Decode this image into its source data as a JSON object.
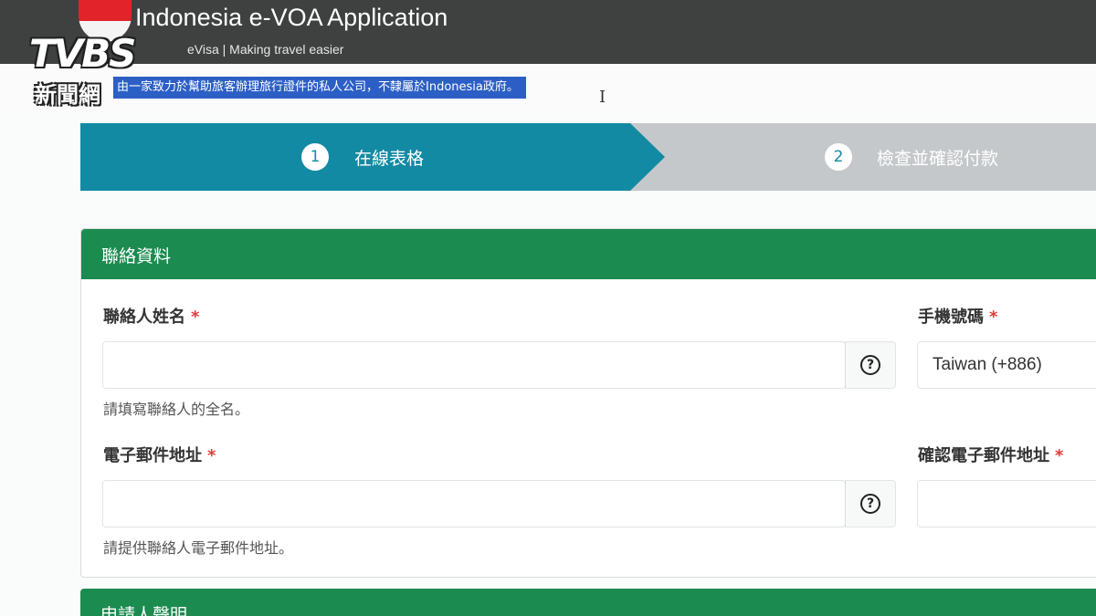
{
  "header": {
    "title": "Indonesia e-VOA Application",
    "subtitle": "eVisa | Making travel easier"
  },
  "watermark": {
    "logo": "TVBS",
    "channel": "新聞網"
  },
  "disclaimer": "由一家致力於幫助旅客辦理旅行證件的私人公司，不隸屬於Indonesia政府。",
  "steps": [
    {
      "number": "1",
      "label": "在線表格",
      "active": true
    },
    {
      "number": "2",
      "label": "檢查並確認付款",
      "active": false
    }
  ],
  "contact_section": {
    "title": "聯絡資料",
    "contact_name": {
      "label": "聯絡人姓名",
      "required_mark": "*",
      "value": "",
      "hint": "請填寫聯絡人的全名。",
      "help_icon": "question-circle-icon"
    },
    "phone": {
      "label": "手機號碼",
      "required_mark": "*",
      "value": "Taiwan (+886)"
    },
    "email": {
      "label": "電子郵件地址",
      "required_mark": "*",
      "value": "",
      "hint": "請提供聯絡人電子郵件地址。",
      "help_icon": "question-circle-icon"
    },
    "confirm_email": {
      "label": "確認電子郵件地址",
      "required_mark": "*",
      "value": ""
    }
  },
  "applicant_section": {
    "title": "申請人聲明"
  },
  "colors": {
    "header_bg": "#3f4141",
    "step_active": "#138aa3",
    "step_inactive": "#c5c8cb",
    "section_header": "#1c8b50",
    "selection": "#2c5fc6",
    "required": "#e23a3a"
  }
}
